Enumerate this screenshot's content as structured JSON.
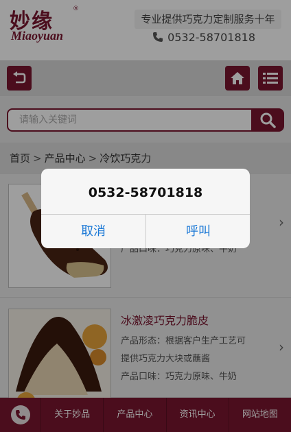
{
  "header": {
    "logo_cn": "妙缘",
    "logo_registered": "®",
    "logo_en": "Miaoyuan",
    "slogan": "专业提供巧克力定制服务十年",
    "phone": "0532-58701818",
    "phone_icon": "phone-icon"
  },
  "toolbar": {
    "back_icon": "back-arrow-icon",
    "home_icon": "home-icon",
    "menu_icon": "list-menu-icon"
  },
  "search": {
    "placeholder": "请输入关键词",
    "icon": "search-icon"
  },
  "breadcrumb": {
    "items": [
      "首页",
      "产品中心",
      "冷饮巧克力"
    ],
    "separator": ">"
  },
  "products": [
    {
      "title": "",
      "line1": "",
      "line2": "产品口味：巧克力原味、牛奶"
    },
    {
      "title": "冰激凌巧克力脆皮",
      "line1": "产品形态：根据客户生产工艺可",
      "line2": "提供巧克力大块或蘸酱",
      "line3": "产品口味：巧克力原味、牛奶"
    }
  ],
  "bottom_nav": {
    "phone_icon": "phone-icon",
    "items": [
      "关于妙品",
      "产品中心",
      "资讯中心",
      "网站地图"
    ]
  },
  "dialog": {
    "number": "0532-58701818",
    "cancel": "取消",
    "call": "呼叫"
  },
  "colors": {
    "brand": "#7a1630",
    "dialog_button": "#1a78d6"
  }
}
